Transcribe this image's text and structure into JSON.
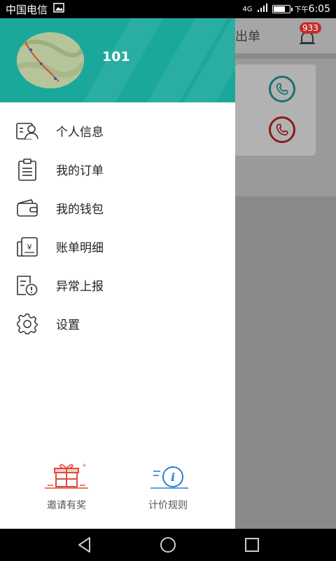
{
  "status_bar": {
    "carrier": "中国电信",
    "network": "4G",
    "time_prefix": "下午",
    "time": "6:05"
  },
  "background_app": {
    "tab_label": "出单",
    "notification_count": "933"
  },
  "drawer": {
    "username": "101",
    "menu": [
      {
        "label": "个人信息",
        "icon": "personal-info-icon"
      },
      {
        "label": "我的订单",
        "icon": "clipboard-icon"
      },
      {
        "label": "我的钱包",
        "icon": "wallet-icon"
      },
      {
        "label": "账单明细",
        "icon": "bill-icon"
      },
      {
        "label": "异常上报",
        "icon": "report-warning-icon"
      },
      {
        "label": "设置",
        "icon": "gear-icon"
      }
    ],
    "bottom_actions": [
      {
        "label": "邀请有奖",
        "icon": "gift-icon"
      },
      {
        "label": "计价规则",
        "icon": "info-icon"
      }
    ]
  },
  "colors": {
    "header_teal": "#1aa89b",
    "badge_red": "#c42b2b",
    "gift_red": "#e04a3c",
    "info_blue": "#2c7fd6"
  }
}
